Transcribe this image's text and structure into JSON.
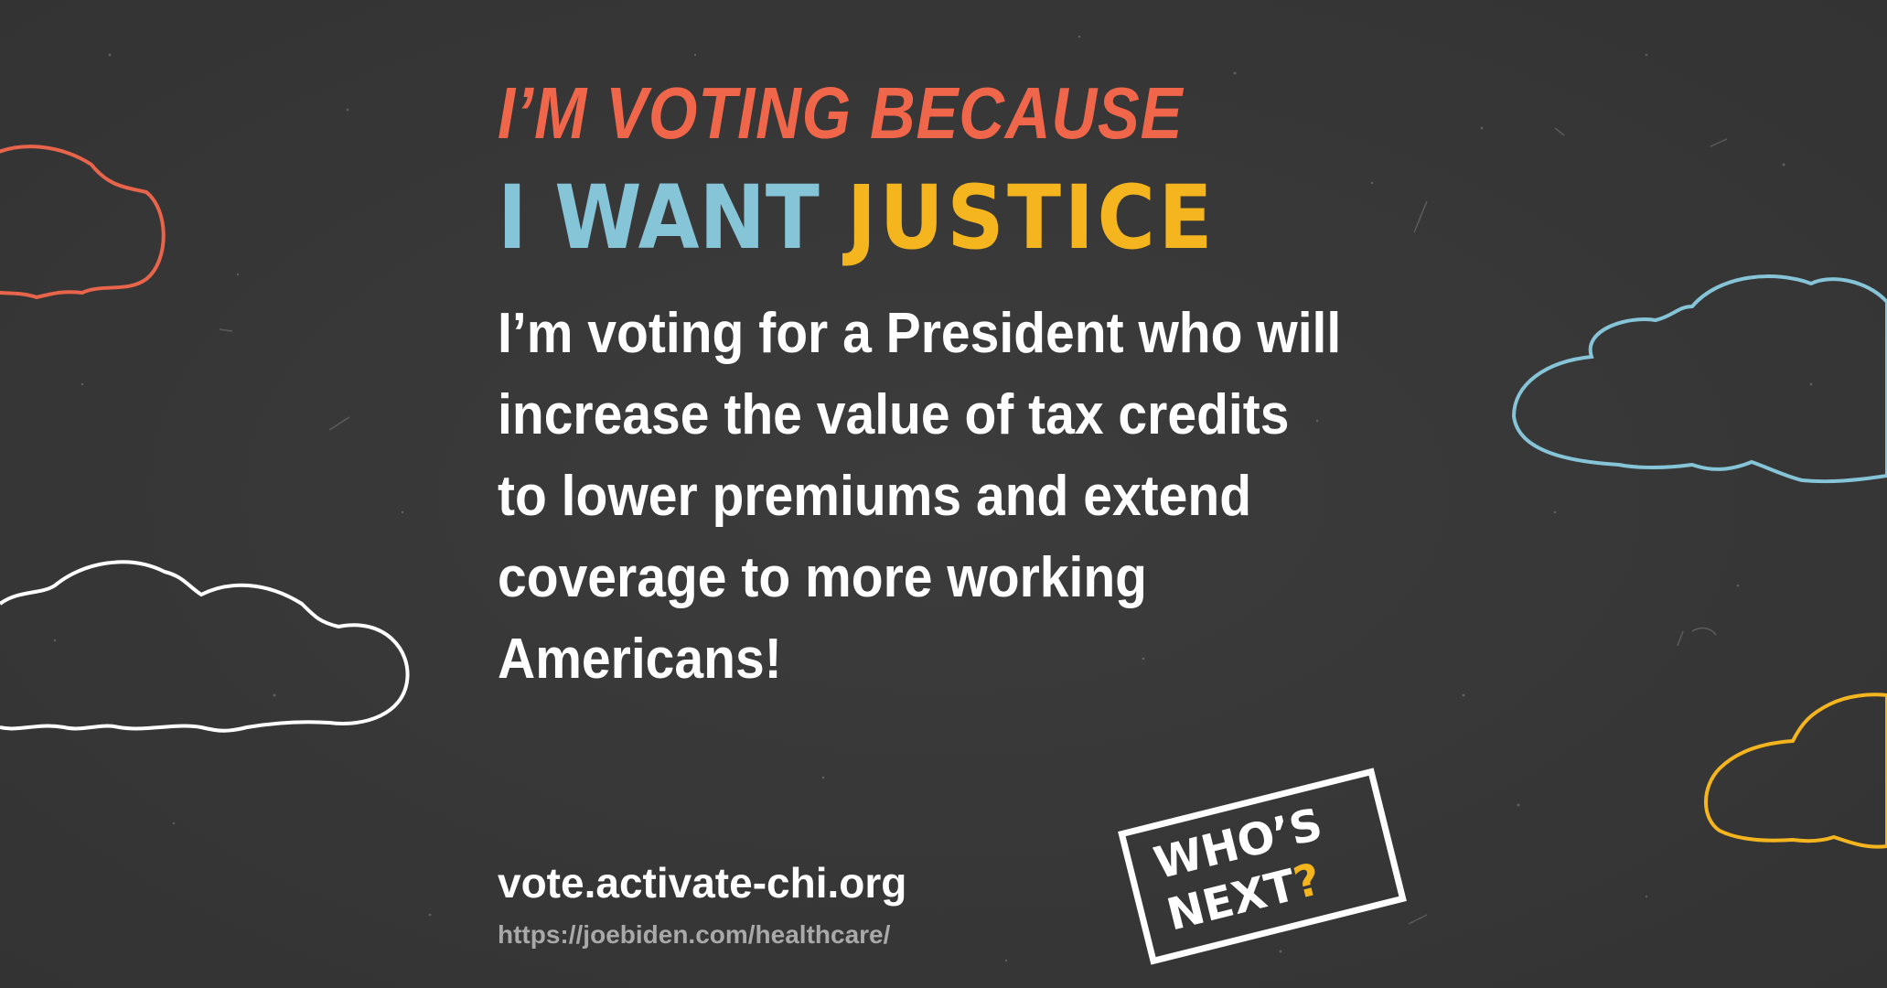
{
  "kicker": "I’M VOTING BECAUSE",
  "headline": {
    "part1": "I WANT",
    "part2": "JUSTICE"
  },
  "body_lines": [
    "I’m voting for a President who will",
    "increase the value of tax credits",
    "to lower premiums and extend",
    "coverage to more working",
    "Americans!"
  ],
  "site_url": "vote.activate-chi.org",
  "source_url": "https://joebiden.com/healthcare/",
  "badge": {
    "line1": "WHO’S",
    "line2": "NEXT",
    "mark": "?"
  },
  "colors": {
    "background": "#383838",
    "kicker": "#f0664a",
    "headline_blue": "#86c5d8",
    "headline_yellow": "#f5b51e",
    "cloud_red": "#e8644a",
    "cloud_white": "#ffffff",
    "cloud_blue": "#86c5d8",
    "cloud_yellow": "#f5b51e"
  },
  "icons": [
    "cloud-outline-icon",
    "whos-next-logo"
  ]
}
